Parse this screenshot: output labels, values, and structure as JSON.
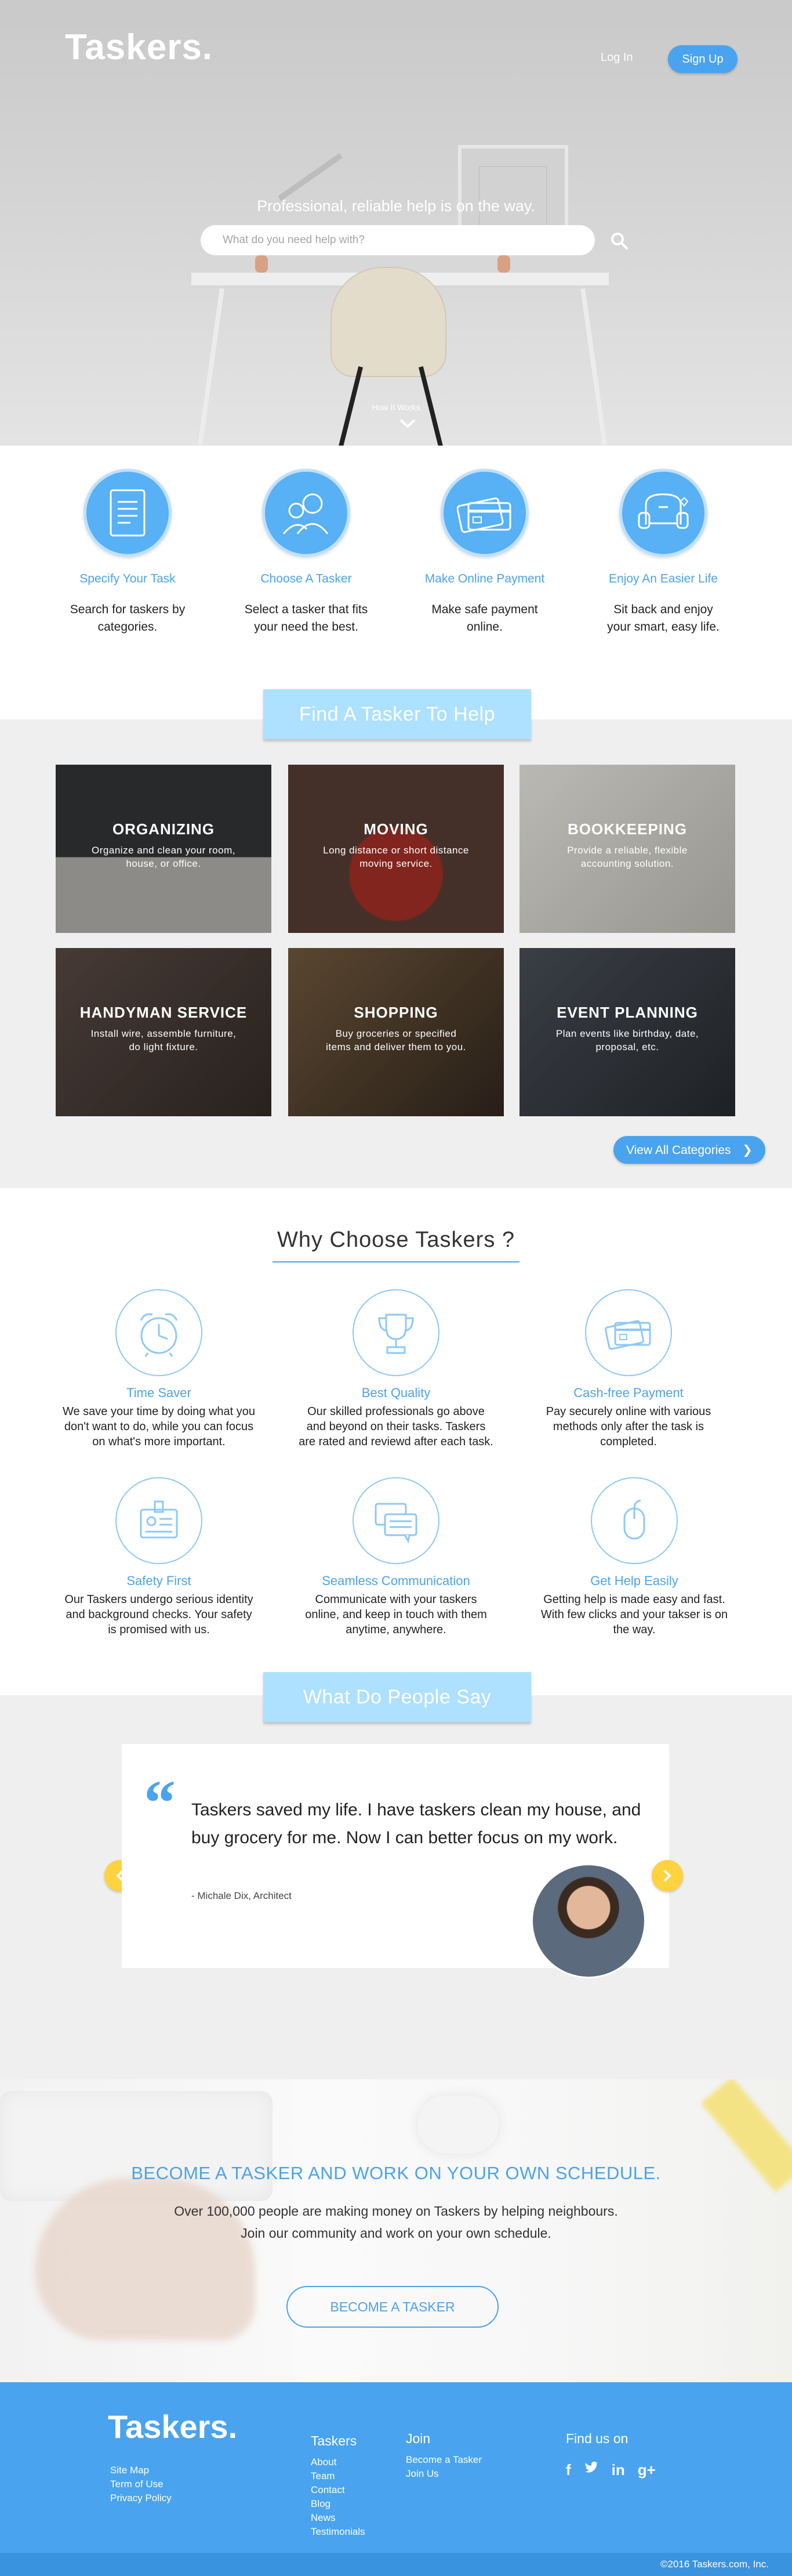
{
  "header": {
    "brand": "Taskers.",
    "login_label": "Log In",
    "signup_label": "Sign Up"
  },
  "hero": {
    "tagline": "Professional, reliable help is on the way.",
    "search_placeholder": "What do you need help with?",
    "how_it_works": "How It Works"
  },
  "steps": [
    {
      "title": "Specify Your Task",
      "line1": "Search for taskers by",
      "line2": "categories.",
      "icon": "document-icon"
    },
    {
      "title": "Choose A Tasker",
      "line1": "Select a tasker that fits",
      "line2": "your need the best.",
      "icon": "people-icon"
    },
    {
      "title": "Make Online Payment",
      "line1": "Make safe payment",
      "line2": "online.",
      "icon": "credit-card-icon"
    },
    {
      "title": "Enjoy An Easier Life",
      "line1": "Sit back and enjoy",
      "line2": "your smart, easy life.",
      "icon": "armchair-icon"
    }
  ],
  "find": {
    "heading": "Find A Tasker To Help",
    "view_all": "View All Categories",
    "categories": [
      {
        "title": "ORGANIZING",
        "desc": "Organize and clean your room, house, or office.",
        "color": "#6b6f71"
      },
      {
        "title": "MOVING",
        "desc": "Long distance or short distance moving service.",
        "color": "#a13a33"
      },
      {
        "title": "BOOKKEEPING",
        "desc": "Provide a reliable, flexible accounting solution.",
        "color": "#cfcfca"
      },
      {
        "title": "HANDYMAN SERVICE",
        "desc": "Install wire, assemble furniture, do light fixture.",
        "color": "#5b4a44"
      },
      {
        "title": "SHOPPING",
        "desc": "Buy groceries or specified items and deliver them to you.",
        "color": "#5a4634"
      },
      {
        "title": "EVENT PLANNING",
        "desc": "Plan events like birthday, date, proposal, etc.",
        "color": "#4a5058"
      }
    ]
  },
  "why": {
    "heading": "Why Choose Taskers ?",
    "features": [
      {
        "title": "Time Saver",
        "desc": [
          "We save your time by doing what you",
          "don't want to do, while you can focus",
          "on what's more important."
        ],
        "icon": "alarm-clock-icon"
      },
      {
        "title": "Best Quality",
        "desc": [
          "Our skilled professionals go above",
          "and beyond on their tasks. Taskers",
          "are rated and reviewd after each task."
        ],
        "icon": "trophy-icon"
      },
      {
        "title": "Cash-free Payment",
        "desc": [
          "Pay securely online with various",
          "methods only after the task is",
          "completed."
        ],
        "icon": "credit-card-icon"
      },
      {
        "title": "Safety First",
        "desc": [
          "Our Taskers undergo serious identity",
          "and background checks. Your safety",
          "is promised with us."
        ],
        "icon": "id-badge-icon"
      },
      {
        "title": "Seamless Communication",
        "desc": [
          "Communicate with your taskers",
          "online, and keep in touch  with them",
          "anytime, anywhere."
        ],
        "icon": "chat-bubbles-icon"
      },
      {
        "title": "Get Help Easily",
        "desc": [
          "Getting help is made easy and fast.",
          "With few clicks and your takser is on",
          "the way."
        ],
        "icon": "mouse-icon"
      }
    ]
  },
  "say": {
    "heading": "What Do People Say",
    "quote": "Taskers saved my life. I have taskers clean my house, and buy grocery for me. Now I can better focus on my work.",
    "author": "- Michale Dix, Architect"
  },
  "tasker": {
    "heading": "BECOME A TASKER AND WORK ON YOUR OWN SCHEDULE.",
    "line1": "Over 100,000 people are making money on Taskers by helping neighbours.",
    "line2": "Join our community and work on your own schedule.",
    "button": "BECOME A TASKER"
  },
  "footer": {
    "brand": "Taskers.",
    "left_links": [
      "Site Map",
      "Term  of Use",
      "Privacy Policy"
    ],
    "taskers_heading": "Taskers",
    "taskers_links": [
      "About",
      "Team",
      "Contact",
      "Blog",
      "News",
      "Testimonials"
    ],
    "join_heading": "Join",
    "join_links": [
      "Become a Tasker",
      "Join Us"
    ],
    "find_heading": "Find us on",
    "social": [
      "facebook-icon",
      "twitter-icon",
      "linkedin-icon",
      "google-plus-icon"
    ],
    "copyright": "©2016 Taskers.com, Inc."
  },
  "colors": {
    "accent": "#4aa3ee",
    "ribbon": "#aee0ff",
    "arrow": "#ffd23f"
  }
}
